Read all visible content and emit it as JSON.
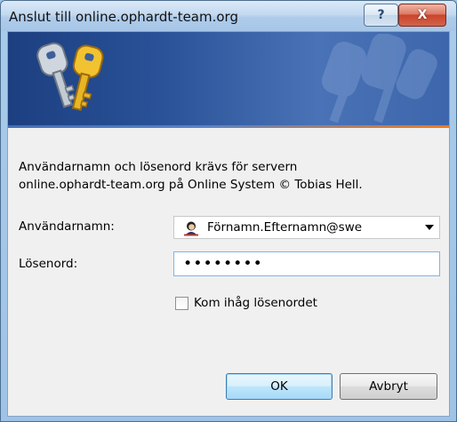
{
  "window": {
    "title": "Anslut till online.ophardt-team.org",
    "help_label": "?",
    "close_label": "X"
  },
  "banner": {
    "logo_icon": "keys-icon",
    "watermark_icon": "keys-watermark-icon",
    "accent_color": "#f07a1e"
  },
  "message": {
    "line1": "Användarnamn och lösenord krävs för servern",
    "line2": "online.ophardt-team.org på Online System © Tobias Hell."
  },
  "form": {
    "username_label": "Användarnamn:",
    "username_value": "Förnamn.Efternamn@swe",
    "username_icon": "user-avatar-icon",
    "password_label": "Lösenord:",
    "password_value": "••••••••",
    "remember_label": "Kom ihåg lösenordet",
    "remember_checked": false
  },
  "buttons": {
    "ok_label": "OK",
    "cancel_label": "Avbryt"
  }
}
